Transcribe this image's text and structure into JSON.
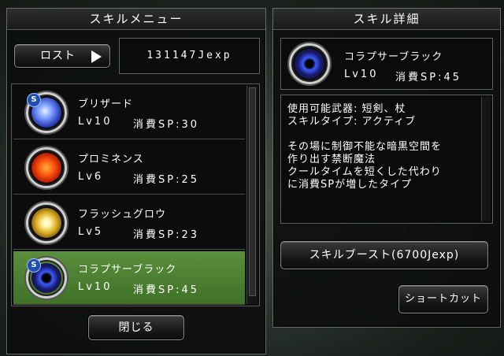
{
  "left_panel": {
    "title": "スキルメニュー",
    "lost_button_label": "ロスト",
    "exp_value": "131147Jexp",
    "close_button_label": "閉じる"
  },
  "skills": [
    {
      "name": "ブリザード",
      "lv": "Lv10",
      "sp": "消費SP:30",
      "orb": "blizzard-icon",
      "badge": "S",
      "selected": false
    },
    {
      "name": "プロミネンス",
      "lv": "Lv6",
      "sp": "消費SP:25",
      "orb": "prominence-icon",
      "badge": "",
      "selected": false
    },
    {
      "name": "フラッシュグロウ",
      "lv": "Lv5",
      "sp": "消費SP:23",
      "orb": "flash-glow-icon",
      "badge": "",
      "selected": false
    },
    {
      "name": "コラプサーブラック",
      "lv": "Lv10",
      "sp": "消費SP:45",
      "orb": "collapsar-black-icon",
      "badge": "S",
      "selected": true
    }
  ],
  "right_panel": {
    "title": "スキル詳細",
    "skill_name": "コラプサーブラック",
    "skill_lv": "Lv10",
    "skill_sp": "消費SP:45",
    "description_lines": [
      "使用可能武器: 短剣、杖",
      "スキルタイプ: アクティブ",
      "",
      "その場に制御不能な暗黒空間を",
      "作り出す禁断魔法",
      "クールタイムを短くした代わり",
      "に消費SPが増したタイプ"
    ],
    "boost_button_label": "スキルブースト(6700Jexp)",
    "shortcut_button_label": "ショートカット"
  },
  "colors": {
    "selected_row": "#4f8a32",
    "panel_bg": "#0e0e0e",
    "border": "#6b6b6b"
  }
}
